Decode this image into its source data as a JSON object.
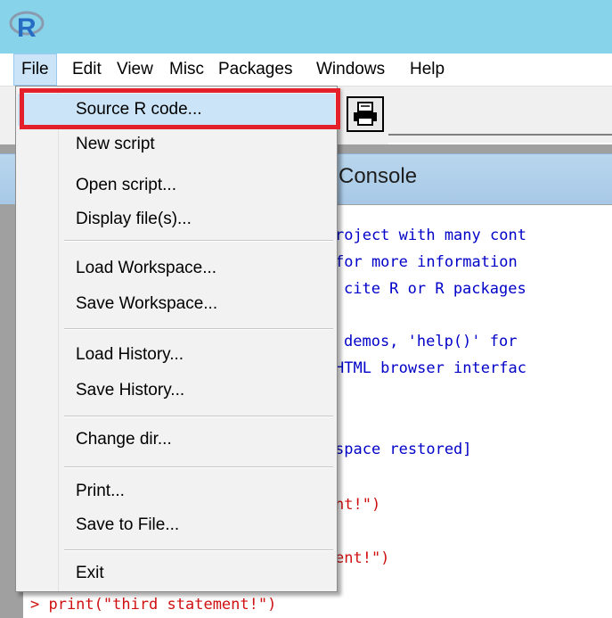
{
  "titlebar": {
    "logo_text": "R",
    "logo_color": "#276dc3"
  },
  "menubar": {
    "items": [
      "File",
      "Edit",
      "View",
      "Misc",
      "Packages",
      "Windows",
      "Help"
    ],
    "active": "File"
  },
  "toolbar": {
    "print_icon": "printer-icon"
  },
  "console": {
    "title": "R Console",
    "title_visible": "Console",
    "lines": [
      "roject with many cont",
      "for more information",
      "cite R or R packages",
      "demos, 'help()' for",
      "HTML browser interfac",
      "space restored]",
      "nt!\")",
      "ent!\")",
      "> print(\"third statement!\")"
    ]
  },
  "file_menu": {
    "items": [
      "Source R code...",
      "New script",
      "Open script...",
      "Display file(s)...",
      "Load Workspace...",
      "Save Workspace...",
      "Load History...",
      "Save History...",
      "Change dir...",
      "Print...",
      "Save to File...",
      "Exit"
    ],
    "highlighted": "Source R code..."
  },
  "colors": {
    "titlebar": "#87d3e9",
    "highlight_box": "#e4202a",
    "menu_hover": "#cce4f7",
    "console_blue": "#0000c8",
    "console_red": "#d01010"
  }
}
